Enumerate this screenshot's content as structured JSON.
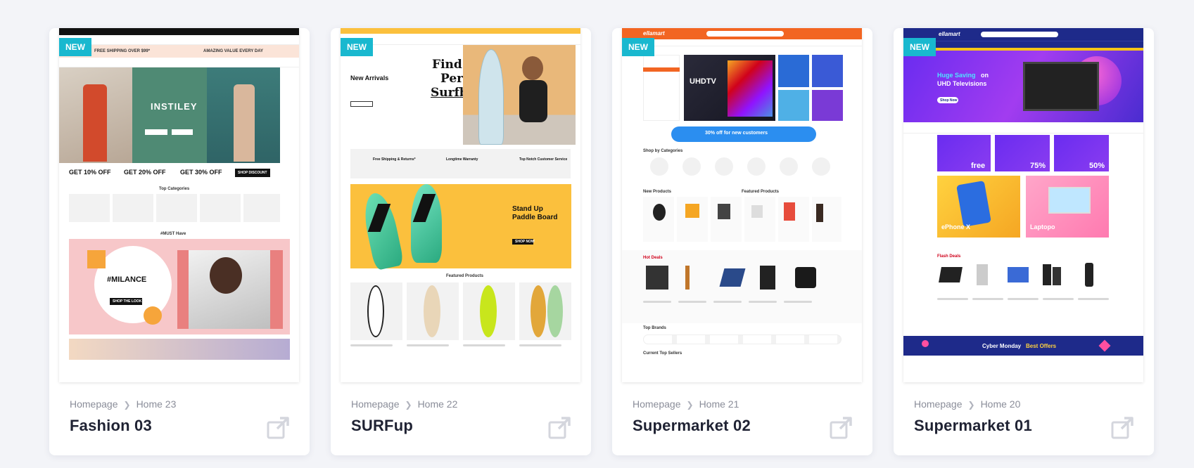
{
  "badge_label": "NEW",
  "cards": [
    {
      "breadcrumb_home": "Homepage",
      "breadcrumb_page": "Home 23",
      "title": "Fashion 03",
      "preview": {
        "promo_left": "FREE SHIPPING OVER $99*",
        "promo_right": "AMAZING VALUE EVERY DAY",
        "hero_title": "INSTILEY",
        "offers": [
          "GET 10% OFF",
          "GET 20% OFF",
          "GET 30% OFF"
        ],
        "shop_button": "SHOP DISCOUNT",
        "section_title": "Top Categories",
        "hashtag_section": "#MUST Have",
        "banner_title": "#MILANCE",
        "banner_button": "SHOP THE LOOK"
      }
    },
    {
      "breadcrumb_home": "Homepage",
      "breadcrumb_page": "Home 22",
      "title": "SURFup",
      "preview": {
        "hero_left": "New Arrivals",
        "hero_title_1": "Find Your",
        "hero_title_2": "Perfect",
        "hero_title_3": "Surfboard",
        "feature_1": "Free Shipping & Returns*",
        "feature_2": "Longtime Warranty",
        "feature_3": "Top Notch Customer Service",
        "promo_title_1": "Stand Up",
        "promo_title_2": "Paddle Board",
        "promo_button": "SHOP NOW",
        "section_title": "Featured Products"
      }
    },
    {
      "breadcrumb_home": "Homepage",
      "breadcrumb_page": "Home 21",
      "title": "Supermarket 02",
      "preview": {
        "logo": "ellamart",
        "hero_title": "UHDTV",
        "coupon": "30% off for new customers",
        "section_1": "Shop by Categories",
        "section_2": "New Products",
        "section_3": "Featured Products",
        "section_4": "Hot Deals",
        "section_5": "Top Brands",
        "section_6": "Current Top Sellers"
      }
    },
    {
      "breadcrumb_home": "Homepage",
      "breadcrumb_page": "Home 20",
      "title": "Supermarket 01",
      "preview": {
        "logo": "ellamart",
        "hero_title_1": "Huge Saving",
        "hero_title_on": "on",
        "hero_title_2": "UHD Televisions",
        "hero_button": "Shop Now",
        "tile_1": "free",
        "tile_2": "75%",
        "tile_3": "50%",
        "tile_4": "ePhone X",
        "tile_5": "Laptopo",
        "section_title": "Flash Deals",
        "footer_banner_1": "Cyber Monday",
        "footer_banner_2": "Best Offers"
      }
    }
  ],
  "colors": {
    "badge": "#19b8cf",
    "surf_yellow": "#fbc03d",
    "ella_orange": "#f26522",
    "ella_navy": "#1e2a8a"
  }
}
